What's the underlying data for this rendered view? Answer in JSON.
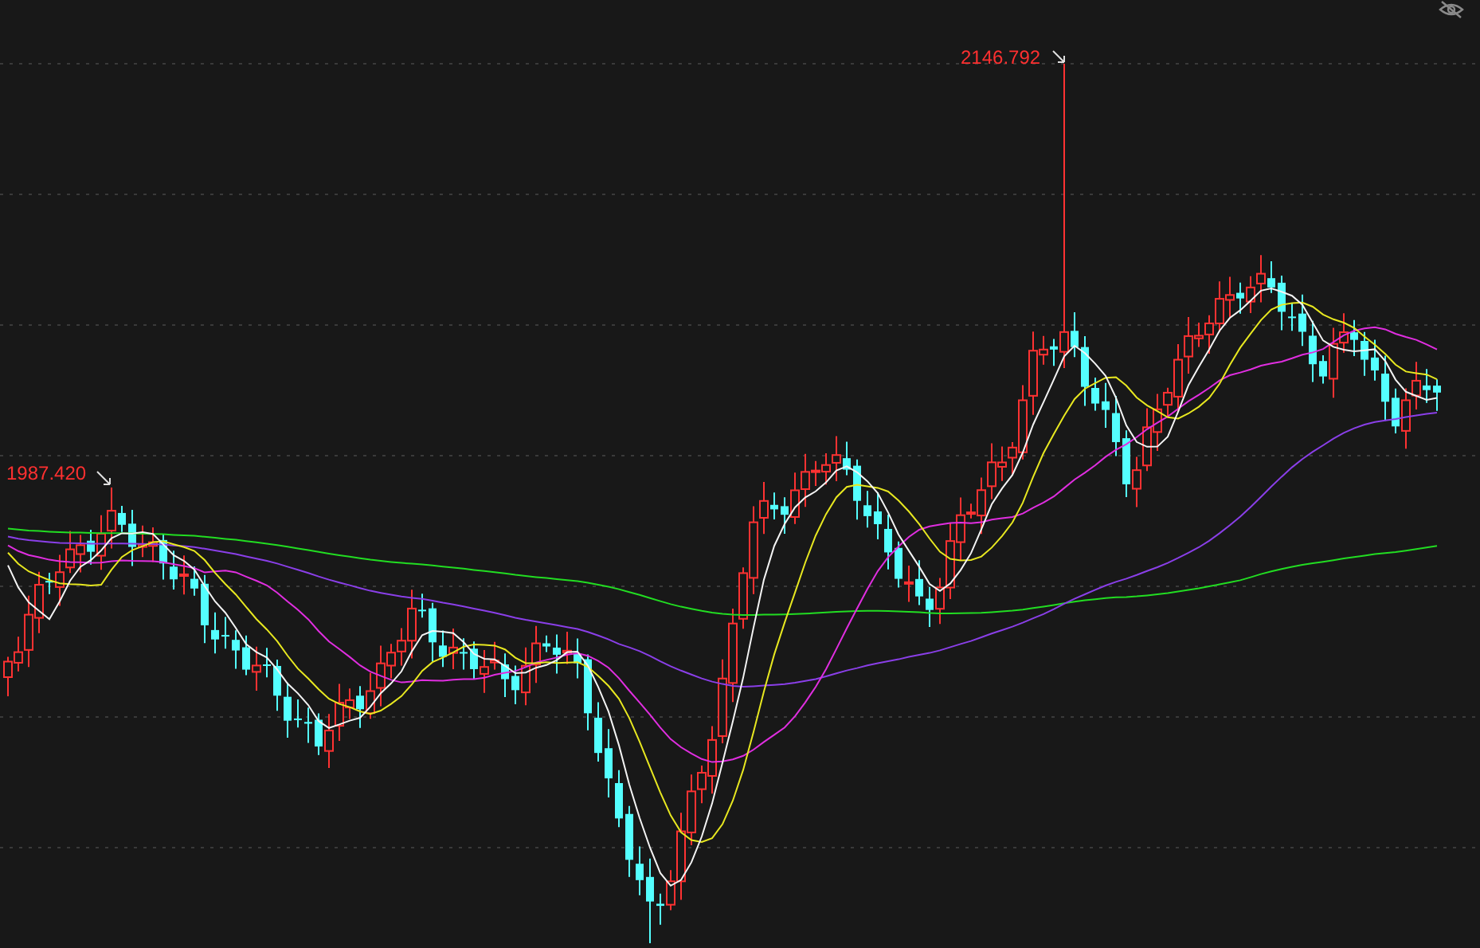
{
  "chart": {
    "high_marker": {
      "label": "2146.792"
    },
    "low_marker": {
      "label": "1987.420"
    }
  }
}
